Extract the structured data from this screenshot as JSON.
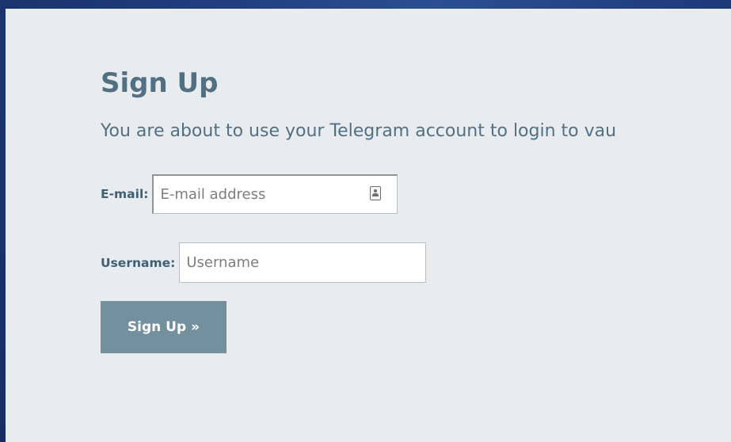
{
  "page": {
    "title": "Sign Up",
    "intro": "You are about to use your Telegram account to login to vau"
  },
  "form": {
    "email": {
      "label": "E-mail:",
      "placeholder": "E-mail address",
      "value": "",
      "icon": "contact-card-icon"
    },
    "username": {
      "label": "Username:",
      "placeholder": "Username",
      "value": ""
    },
    "submit_label": "Sign Up »"
  },
  "colors": {
    "background": "#1e3a78",
    "panel": "#e9ecef",
    "heading": "#527084",
    "label": "#3f5f75",
    "button": "#748f9e",
    "button_text": "#ffffff"
  }
}
